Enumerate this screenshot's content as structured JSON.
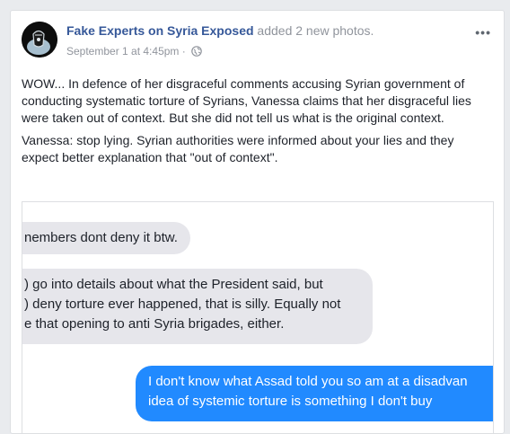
{
  "post": {
    "page_name": "Fake Experts on Syria Exposed",
    "action_text": " added 2 new photos.",
    "date": "September 1 at 4:45pm",
    "separator": " · ",
    "options_glyph": "•••",
    "paragraphs": [
      "WOW... In defence of her disgraceful comments accusing Syrian government of conducting systematic torture of Syrians, Vanessa claims that her disgraceful lies were taken out of context. But she did not tell us what is the original context.",
      "Vanessa: stop lying. Syrian authorities were informed about your lies and they expect better explanation that \"out of context\"."
    ]
  },
  "photo": {
    "messages": [
      {
        "side": "incoming",
        "lines": [
          "nembers dont deny it btw."
        ]
      },
      {
        "side": "incoming",
        "lines": [
          ") go into details about what the President said, but",
          ") deny torture ever happened, that is silly. Equally not",
          "e that opening to anti Syria brigades, either."
        ]
      },
      {
        "side": "outgoing",
        "lines": [
          "I don't know what Assad told you so am at a disadvan",
          "idea of systemic torture is something I don't buy"
        ]
      }
    ]
  },
  "icons": {
    "avatar": "page-avatar-logo",
    "privacy": "globe-icon",
    "options": "more-options-icon"
  },
  "colors": {
    "link": "#365899",
    "muted": "#90949c",
    "outgoing_bubble": "#218aff",
    "incoming_bubble": "#e6e6eb"
  }
}
